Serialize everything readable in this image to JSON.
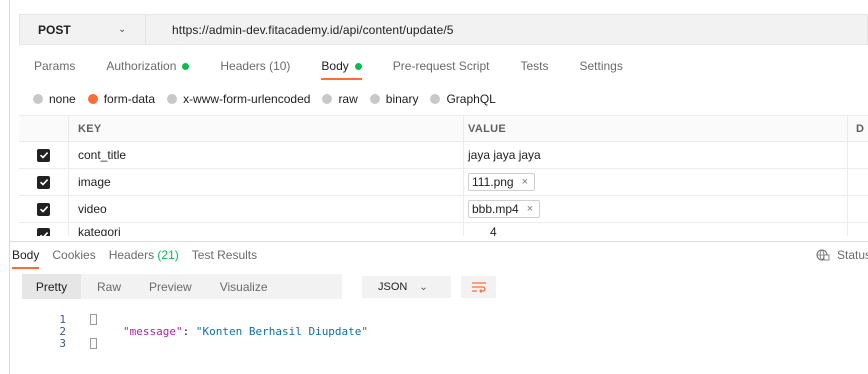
{
  "request": {
    "method": "POST",
    "url": "https://admin-dev.fitacademy.id/api/content/update/5"
  },
  "request_tabs": [
    {
      "label": "Params",
      "dot": false,
      "active": false
    },
    {
      "label": "Authorization",
      "dot": true,
      "active": false
    },
    {
      "label": "Headers (10)",
      "dot": false,
      "active": false
    },
    {
      "label": "Body",
      "dot": true,
      "active": true
    },
    {
      "label": "Pre-request Script",
      "dot": false,
      "active": false
    },
    {
      "label": "Tests",
      "dot": false,
      "active": false
    },
    {
      "label": "Settings",
      "dot": false,
      "active": false
    }
  ],
  "body_types": [
    {
      "label": "none",
      "selected": false
    },
    {
      "label": "form-data",
      "selected": true
    },
    {
      "label": "x-www-form-urlencoded",
      "selected": false
    },
    {
      "label": "raw",
      "selected": false
    },
    {
      "label": "binary",
      "selected": false
    },
    {
      "label": "GraphQL",
      "selected": false
    }
  ],
  "params_table": {
    "headers": {
      "key": "KEY",
      "value": "VALUE",
      "description": "D"
    },
    "rows": [
      {
        "key": "cont_title",
        "value": "jaya jaya jaya",
        "is_file": false,
        "checked": true
      },
      {
        "key": "image",
        "value": "111.png",
        "is_file": true,
        "checked": true
      },
      {
        "key": "video",
        "value": "bbb.mp4",
        "is_file": true,
        "checked": true
      },
      {
        "key": "kategori",
        "value": "4",
        "is_file": false,
        "checked": true
      }
    ],
    "remove_glyph": "×"
  },
  "response_tabs": {
    "body": "Body",
    "cookies": "Cookies",
    "headers_label": "Headers",
    "headers_count": "(21)",
    "test_results": "Test Results"
  },
  "status_label": "Status",
  "view_tabs": [
    "Pretty",
    "Raw",
    "Preview",
    "Visualize"
  ],
  "format": "JSON",
  "code": {
    "line_numbers": [
      "1",
      "2",
      "3"
    ],
    "key": "\"message\"",
    "colon": ": ",
    "value": "\"Konten Berhasil Diupdate\""
  },
  "colors": {
    "accent": "#ff6c37",
    "success_dot": "#0cbb52",
    "json_key": "#a626a4",
    "json_string": "#0f6fa7"
  }
}
